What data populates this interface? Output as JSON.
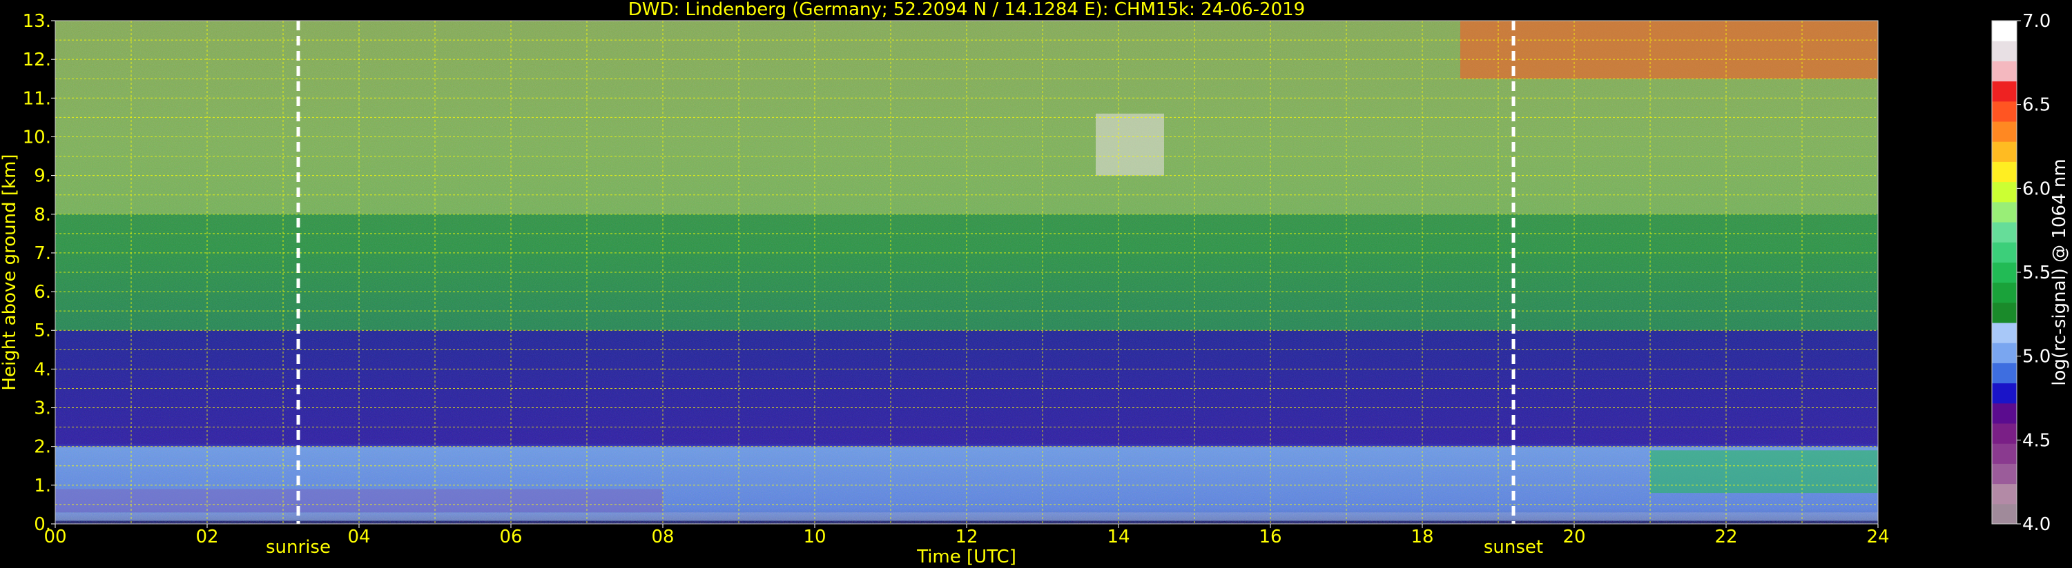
{
  "chart_data": {
    "type": "heatmap",
    "title": "DWD: Lindenberg (Germany; 52.2094 N / 14.1284 E):    CHM15k: 24-06-2019",
    "xlabel": "Time [UTC]",
    "ylabel": "Height above ground [km]",
    "xlim": [
      0,
      24
    ],
    "ylim": [
      0,
      13
    ],
    "x_ticks": [
      "00",
      "02",
      "04",
      "06",
      "08",
      "10",
      "12",
      "14",
      "16",
      "18",
      "20",
      "22",
      "24"
    ],
    "y_ticks": [
      "0.",
      "1.",
      "2.",
      "3.",
      "4.",
      "5.",
      "6.",
      "7.",
      "8.",
      "9.",
      "10.",
      "11.",
      "12.",
      "13."
    ],
    "grid": true,
    "events": [
      {
        "label": "sunrise",
        "time": 3.2
      },
      {
        "label": "sunset",
        "time": 19.2
      }
    ],
    "colorbar": {
      "label": "log(rc-signal) @ 1064 nm",
      "range": [
        4.0,
        7.0
      ],
      "ticks": [
        "4.0",
        "4.5",
        "5.0",
        "5.5",
        "6.0",
        "6.5",
        "7.0"
      ],
      "colors": [
        "#a08a9a",
        "#b38aa6",
        "#9b5c9a",
        "#8a3a8f",
        "#7a1f86",
        "#5b0c8f",
        "#1a14c8",
        "#3e6ee0",
        "#7aa6f0",
        "#a8c8f8",
        "#1a8a2a",
        "#1aa23a",
        "#22bb55",
        "#3ccf7a",
        "#66dd99",
        "#99ee77",
        "#ccff33",
        "#ffee22",
        "#ffbb22",
        "#ff8822",
        "#ff5522",
        "#ee2222",
        "#f4b8bf",
        "#e8e0e4",
        "#ffffff"
      ]
    },
    "layers": [
      {
        "t0": 0,
        "t1": 24,
        "h0": 0.08,
        "h1": 0.3,
        "value": 5.1
      },
      {
        "t0": 0,
        "t1": 8,
        "h0": 0.3,
        "h1": 0.9,
        "value": 4.6
      },
      {
        "t0": 0,
        "t1": 24,
        "h0": 0.3,
        "h1": 2.0,
        "value": 5.05
      },
      {
        "t0": 21,
        "t1": 24,
        "h0": 0.8,
        "h1": 1.9,
        "value": 5.45
      },
      {
        "t0": 0,
        "t1": 24,
        "h0": 2.0,
        "h1": 5.0,
        "value": 4.75
      },
      {
        "t0": 0,
        "t1": 24,
        "h0": 5.0,
        "h1": 8.0,
        "value": 5.45
      },
      {
        "t0": 0,
        "t1": 24,
        "h0": 8.0,
        "h1": 13.0,
        "value": 5.8
      },
      {
        "t0": 13.7,
        "t1": 14.6,
        "h0": 9.0,
        "h1": 10.6,
        "value": 6.8
      },
      {
        "t0": 18.5,
        "t1": 24,
        "h0": 11.5,
        "h1": 13.0,
        "value": 6.5
      }
    ]
  }
}
